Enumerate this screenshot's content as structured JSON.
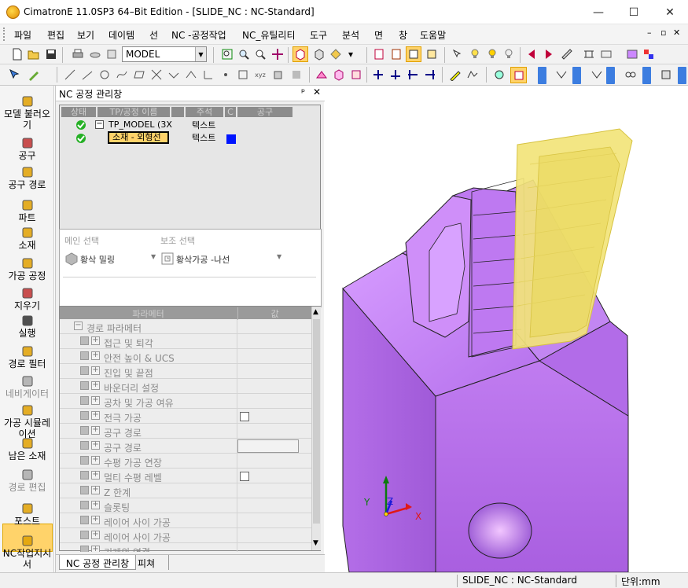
{
  "window": {
    "title": "CimatronE 11.0SP3 64–Bit Edition - [SLIDE_NC : NC-Standard]",
    "minimize": "—",
    "maximize": "☐",
    "close": "✕"
  },
  "menu": [
    "파일",
    "편집",
    "보기",
    "데이템",
    "선",
    "NC -공정작업",
    "NC_유틸리티",
    "도구",
    "분석",
    "면",
    "창",
    "도움말"
  ],
  "toolbar": {
    "model_combo": "MODEL"
  },
  "leftbar": [
    {
      "label": "모델 불러오기",
      "icon": "model-load-icon",
      "enabled": true
    },
    {
      "label": "공구",
      "icon": "tool-icon",
      "enabled": true
    },
    {
      "label": "공구 경로",
      "icon": "toolpath-icon",
      "enabled": true
    },
    {
      "label": "파트",
      "icon": "part-icon",
      "enabled": true
    },
    {
      "label": "소재",
      "icon": "stock-icon",
      "enabled": true
    },
    {
      "label": "가공 공정",
      "icon": "procedure-icon",
      "enabled": true
    },
    {
      "label": "지우기",
      "icon": "delete-icon",
      "enabled": true
    },
    {
      "label": "실행",
      "icon": "execute-icon",
      "enabled": true
    },
    {
      "label": "경로 필터",
      "icon": "path-filter-icon",
      "enabled": true
    },
    {
      "label": "네비게이터",
      "icon": "navigator-icon",
      "enabled": false
    },
    {
      "label": "가공 시뮬레이션",
      "icon": "simulation-icon",
      "enabled": true
    },
    {
      "label": "남은 소재",
      "icon": "remaining-stock-icon",
      "enabled": true,
      "active": true
    },
    {
      "label": "경로 편집",
      "icon": "path-edit-icon",
      "enabled": false
    },
    {
      "label": "포스트",
      "icon": "post-icon",
      "enabled": true
    },
    {
      "label": "NC작업지시서",
      "icon": "nc-sheet-icon",
      "enabled": true
    }
  ],
  "panel": {
    "title": "NC 공정 관리창",
    "pin": "ᵖ",
    "close": "✕",
    "tree_headers": [
      "상태",
      "TP/공정 이름",
      "주석",
      "C",
      "공구"
    ],
    "tree_rows": [
      {
        "status": "ok",
        "expander": "−",
        "name": "TP_MODEL (3X",
        "comment": "텍스트",
        "tool_color": ""
      },
      {
        "status": "ok",
        "expander": "",
        "name": "소재 - 외형선",
        "comment": "텍스트",
        "tool_color": "#0014ff"
      }
    ],
    "main_select_label": "메인 선택",
    "sub_select_label": "보조 선택",
    "main_select_value": "황삭 밀링",
    "sub_select_value": "황삭가공 -나선",
    "param_header": "파라메터",
    "value_header": "값",
    "params": [
      {
        "label": "경로 파라메터",
        "level": 0,
        "exp": "−"
      },
      {
        "label": "접근 및 퇴각",
        "level": 1,
        "exp": "+"
      },
      {
        "label": "안전 높이 & UCS",
        "level": 1,
        "exp": "+"
      },
      {
        "label": "진입 및 끝점",
        "level": 1,
        "exp": "+"
      },
      {
        "label": "바운더리 설정",
        "level": 1,
        "exp": "+"
      },
      {
        "label": "공차 및 가공 여유",
        "level": 1,
        "exp": "+"
      },
      {
        "label": "전극 가공",
        "level": 1,
        "exp": "+",
        "checkbox": true
      },
      {
        "label": "공구 경로",
        "level": 1,
        "exp": "+"
      },
      {
        "label": "공구 경로",
        "level": 1,
        "exp": "+",
        "field": true
      },
      {
        "label": "수평 가공 연장",
        "level": 1,
        "exp": "+"
      },
      {
        "label": "멀티 수평 레벨",
        "level": 1,
        "exp": "+",
        "checkbox": true
      },
      {
        "label": "Z 한계",
        "level": 1,
        "exp": "+"
      },
      {
        "label": "슬롯팅",
        "level": 1,
        "exp": "+"
      },
      {
        "label": "레이어 사이 가공",
        "level": 1,
        "exp": "+"
      },
      {
        "label": "레이어 사이 가공",
        "level": 1,
        "exp": "+"
      },
      {
        "label": "기계의 연결",
        "level": 1,
        "exp": "+"
      }
    ],
    "tabs": [
      "NC 공정 관리창",
      "피쳐"
    ]
  },
  "axes": {
    "x": "X",
    "y": "Y",
    "z": "Z"
  },
  "status": {
    "mode": "SLIDE_NC : NC-Standard",
    "units": "단위:mm"
  },
  "colors": {
    "part": "#b56ae4",
    "stock": "#f2e47a",
    "accent": "#ffd36a"
  }
}
